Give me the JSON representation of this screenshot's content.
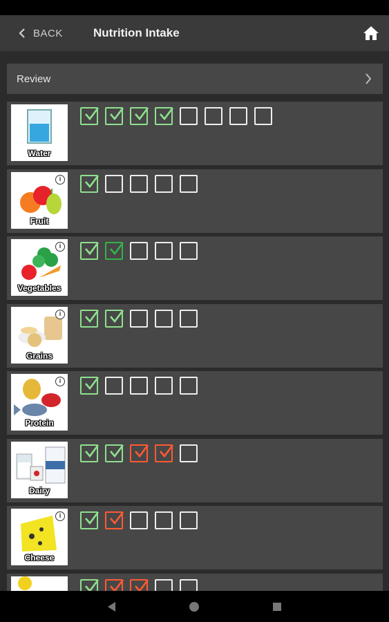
{
  "header": {
    "back_label": "BACK",
    "title": "Nutrition Intake",
    "home_icon": "home-icon"
  },
  "review": {
    "label": "Review"
  },
  "colors": {
    "unchecked": "#eeeeee",
    "checked_light": "#8fe08f",
    "checked_dark": "#34b24a",
    "checked_over": "#ff5a33",
    "row_bg": "#474747",
    "page_bg": "#2b2b2b"
  },
  "categories": [
    {
      "label": "Water",
      "has_info": false,
      "boxes": [
        "light",
        "light",
        "light",
        "light",
        "empty",
        "empty",
        "empty",
        "empty"
      ]
    },
    {
      "label": "Fruit",
      "has_info": true,
      "boxes": [
        "light",
        "empty",
        "empty",
        "empty",
        "empty"
      ]
    },
    {
      "label": "Vegetables",
      "has_info": true,
      "boxes": [
        "light",
        "dark",
        "empty",
        "empty",
        "empty"
      ]
    },
    {
      "label": "Grains",
      "has_info": true,
      "boxes": [
        "light",
        "light",
        "empty",
        "empty",
        "empty"
      ]
    },
    {
      "label": "Protein",
      "has_info": true,
      "boxes": [
        "light",
        "empty",
        "empty",
        "empty",
        "empty"
      ]
    },
    {
      "label": "Dairy",
      "has_info": false,
      "boxes": [
        "light",
        "light",
        "orange",
        "orange",
        "empty"
      ]
    },
    {
      "label": "Cheese",
      "has_info": true,
      "boxes": [
        "light",
        "orange",
        "empty",
        "empty",
        "empty"
      ]
    },
    {
      "label": "",
      "has_info": false,
      "boxes": [
        "light",
        "orange",
        "orange",
        "empty",
        "empty"
      ]
    }
  ],
  "nav": {
    "back": "nav-back-icon",
    "home": "nav-home-icon",
    "recents": "nav-recents-icon"
  }
}
